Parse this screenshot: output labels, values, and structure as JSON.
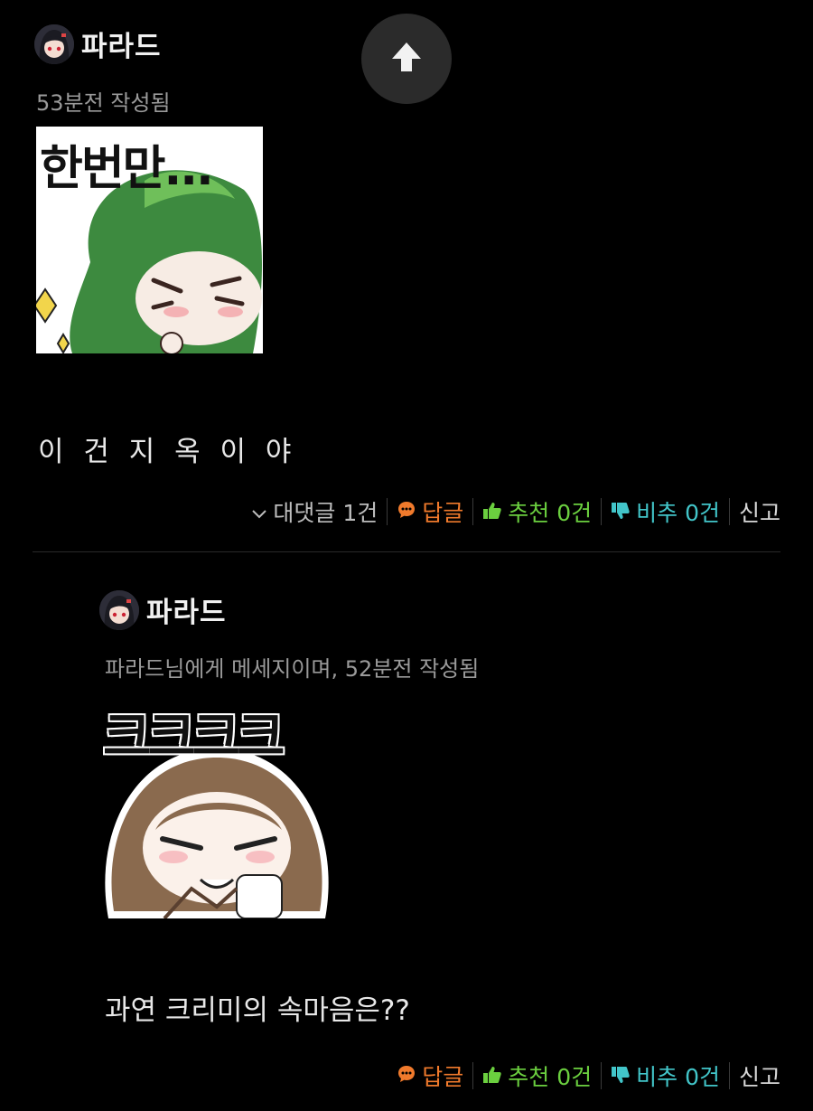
{
  "comments": [
    {
      "author": "파라드",
      "meta": "53분전 작성됨",
      "sticker_text": "한번만...",
      "body": "이 건 지 옥 이 야",
      "actions": {
        "replies": "대댓글 1건",
        "reply": "답글",
        "recommend": "추천 0건",
        "not_recommend": "비추 0건",
        "report": "신고"
      }
    },
    {
      "author": "파라드",
      "meta": "파라드님에게 메세지이며, 52분전 작성됨",
      "sticker_text": "크크크크",
      "body": "과연 크리미의 속마음은??",
      "actions": {
        "reply": "답글",
        "recommend": "추천 0건",
        "not_recommend": "비추 0건",
        "report": "신고"
      }
    }
  ],
  "colors": {
    "background": "#000000",
    "reply": "#f07a2c",
    "recommend": "#6bcf3f",
    "not_recommend": "#42c5c9"
  },
  "icons": [
    "arrow-up-icon",
    "chevron-down-icon",
    "chat-bubble-icon",
    "thumbs-up-icon",
    "thumbs-down-icon"
  ]
}
